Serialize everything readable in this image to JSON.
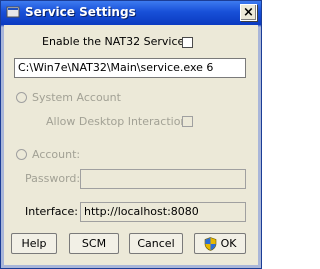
{
  "window": {
    "title": "Service Settings",
    "close_glyph": "×"
  },
  "enable_service": {
    "label": "Enable the NAT32 Service",
    "checked": false
  },
  "path": {
    "value": "C:\\Win7e\\NAT32\\Main\\service.exe 6"
  },
  "system_account": {
    "label": "System Account",
    "enabled": false
  },
  "allow_desktop": {
    "label": "Allow Desktop Interaction",
    "checked": false
  },
  "account": {
    "label": "Account:",
    "enabled": false
  },
  "password": {
    "label": "Password:",
    "value": ""
  },
  "interface": {
    "label": "Interface:",
    "value": "http://localhost:8080"
  },
  "buttons": {
    "help": "Help",
    "scm": "SCM",
    "cancel": "Cancel",
    "ok": "OK"
  },
  "colors": {
    "titlebar": "#0b3ac0",
    "dialog_bg": "#ece9d8",
    "disabled_text": "#a2a195"
  }
}
